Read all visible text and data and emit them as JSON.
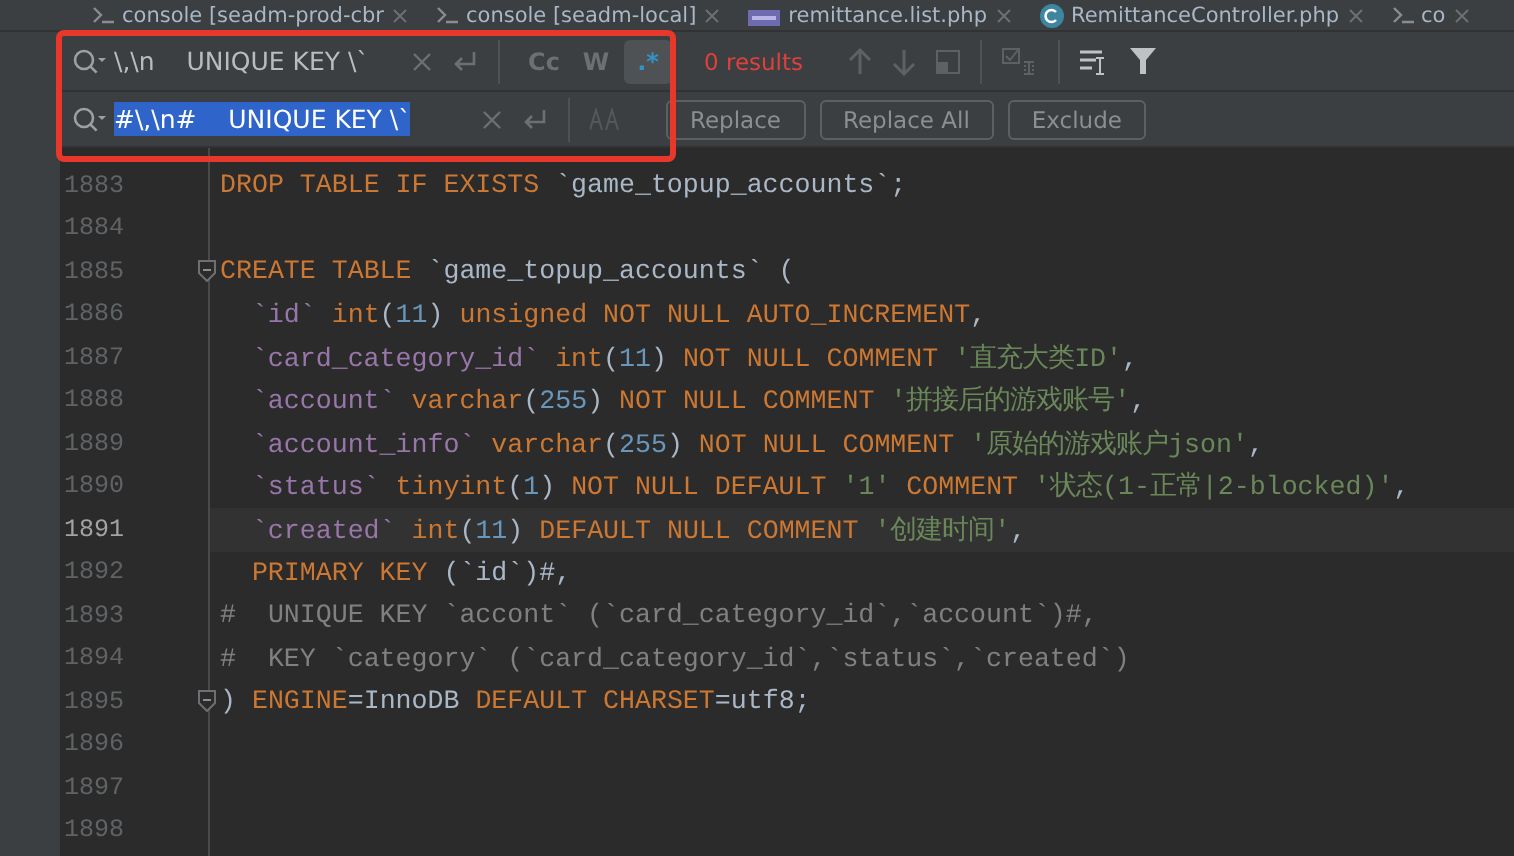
{
  "tabs": [
    {
      "label": "console [seadm-prod-cbr",
      "kind": "console"
    },
    {
      "label": "console [seadm-local]",
      "kind": "console"
    },
    {
      "label": "remittance.list.php",
      "kind": "php"
    },
    {
      "label": "RemittanceController.php",
      "kind": "class"
    },
    {
      "label": "co",
      "kind": "console"
    }
  ],
  "find": {
    "value": "\\,\\n    UNIQUE KEY \\`",
    "options": [
      {
        "label": "Cc",
        "selected": false
      },
      {
        "label": "W",
        "selected": false
      },
      {
        "label": ".*",
        "selected": true
      }
    ],
    "results": "0 results"
  },
  "replace": {
    "value": "#\\,\\n#    UNIQUE KEY \\`",
    "selected_text": true,
    "buttons": [
      "Replace",
      "Replace All",
      "Exclude"
    ]
  },
  "editor": {
    "lines": [
      {
        "number": "1883",
        "current": false,
        "fold": false,
        "indent": false,
        "tokens": [
          {
            "kind": "keyword",
            "text": "DROP TABLE IF EXISTS "
          },
          {
            "kind": "plain",
            "text": "`game_topup_accounts`;"
          }
        ]
      },
      {
        "number": "1884",
        "current": false,
        "fold": false,
        "indent": false
      },
      {
        "number": "1885",
        "current": false,
        "fold": true,
        "indent": false,
        "tokens": [
          {
            "kind": "keyword",
            "text": "CREATE TABLE "
          },
          {
            "kind": "plain",
            "text": "`game_topup_accounts` ("
          }
        ]
      },
      {
        "number": "1886",
        "current": false,
        "fold": false,
        "indent": true,
        "tokens": [
          {
            "kind": "ident",
            "text": "`id`"
          },
          {
            "kind": "keyword",
            "text": " int"
          },
          {
            "kind": "plain",
            "text": "("
          },
          {
            "kind": "number",
            "text": "11"
          },
          {
            "kind": "plain",
            "text": ") "
          },
          {
            "kind": "keyword",
            "text": "unsigned NOT NULL AUTO_INCREMENT"
          },
          {
            "kind": "plain",
            "text": ","
          }
        ]
      },
      {
        "number": "1887",
        "current": false,
        "fold": false,
        "indent": true,
        "tokens": [
          {
            "kind": "ident",
            "text": "`card_category_id`"
          },
          {
            "kind": "keyword",
            "text": " int"
          },
          {
            "kind": "plain",
            "text": "("
          },
          {
            "kind": "number",
            "text": "11"
          },
          {
            "kind": "plain",
            "text": ") "
          },
          {
            "kind": "keyword",
            "text": "NOT NULL COMMENT "
          },
          {
            "kind": "string",
            "text": "'直充大类ID'"
          },
          {
            "kind": "plain",
            "text": ","
          }
        ]
      },
      {
        "number": "1888",
        "current": false,
        "fold": false,
        "indent": true,
        "tokens": [
          {
            "kind": "ident",
            "text": "`account`"
          },
          {
            "kind": "keyword",
            "text": " varchar"
          },
          {
            "kind": "plain",
            "text": "("
          },
          {
            "kind": "number",
            "text": "255"
          },
          {
            "kind": "plain",
            "text": ") "
          },
          {
            "kind": "keyword",
            "text": "NOT NULL COMMENT "
          },
          {
            "kind": "string",
            "text": "'拼接后的游戏账号'"
          },
          {
            "kind": "plain",
            "text": ","
          }
        ]
      },
      {
        "number": "1889",
        "current": false,
        "fold": false,
        "indent": true,
        "tokens": [
          {
            "kind": "ident",
            "text": "`account_info`"
          },
          {
            "kind": "keyword",
            "text": " varchar"
          },
          {
            "kind": "plain",
            "text": "("
          },
          {
            "kind": "number",
            "text": "255"
          },
          {
            "kind": "plain",
            "text": ") "
          },
          {
            "kind": "keyword",
            "text": "NOT NULL COMMENT "
          },
          {
            "kind": "string",
            "text": "'原始的游戏账户json'"
          },
          {
            "kind": "plain",
            "text": ","
          }
        ]
      },
      {
        "number": "1890",
        "current": false,
        "fold": false,
        "indent": true,
        "tokens": [
          {
            "kind": "ident",
            "text": "`status`"
          },
          {
            "kind": "keyword",
            "text": " tinyint"
          },
          {
            "kind": "plain",
            "text": "("
          },
          {
            "kind": "number",
            "text": "1"
          },
          {
            "kind": "plain",
            "text": ") "
          },
          {
            "kind": "keyword",
            "text": "NOT NULL DEFAULT "
          },
          {
            "kind": "string",
            "text": "'1'"
          },
          {
            "kind": "keyword",
            "text": " COMMENT "
          },
          {
            "kind": "string",
            "text": "'状态(1-正常|2-blocked)'"
          },
          {
            "kind": "plain",
            "text": ","
          }
        ]
      },
      {
        "number": "1891",
        "current": true,
        "fold": false,
        "indent": true,
        "tokens": [
          {
            "kind": "ident",
            "text": "`created`"
          },
          {
            "kind": "keyword",
            "text": " int"
          },
          {
            "kind": "plain",
            "text": "("
          },
          {
            "kind": "number",
            "text": "11"
          },
          {
            "kind": "plain",
            "text": ") "
          },
          {
            "kind": "keyword",
            "text": "DEFAULT NULL COMMENT "
          },
          {
            "kind": "string",
            "text": "'创建时间'"
          },
          {
            "kind": "plain",
            "text": ","
          }
        ]
      },
      {
        "number": "1892",
        "current": false,
        "fold": false,
        "indent": true,
        "tokens": [
          {
            "kind": "keyword",
            "text": "PRIMARY KEY "
          },
          {
            "kind": "plain",
            "text": "(`id`)#,"
          }
        ]
      },
      {
        "number": "1893",
        "current": false,
        "fold": false,
        "indent": false,
        "tokens": [
          {
            "kind": "comment",
            "text": "#  UNIQUE KEY `accont` (`card_category_id`,`account`)#,"
          }
        ]
      },
      {
        "number": "1894",
        "current": false,
        "fold": false,
        "indent": false,
        "tokens": [
          {
            "kind": "comment",
            "text": "#  KEY `category` (`card_category_id`,`status`,`created`)"
          }
        ]
      },
      {
        "number": "1895",
        "current": false,
        "fold": true,
        "indent": false,
        "tokens": [
          {
            "kind": "plain",
            "text": ") "
          },
          {
            "kind": "keyword",
            "text": "ENGINE"
          },
          {
            "kind": "plain",
            "text": "=InnoDB "
          },
          {
            "kind": "keyword",
            "text": "DEFAULT CHARSET"
          },
          {
            "kind": "plain",
            "text": "=utf8;"
          }
        ]
      },
      {
        "number": "1896",
        "current": false,
        "fold": false,
        "indent": false
      },
      {
        "number": "1897",
        "current": false,
        "fold": false,
        "indent": false
      },
      {
        "number": "1898",
        "current": false,
        "fold": false,
        "indent": false
      }
    ]
  }
}
